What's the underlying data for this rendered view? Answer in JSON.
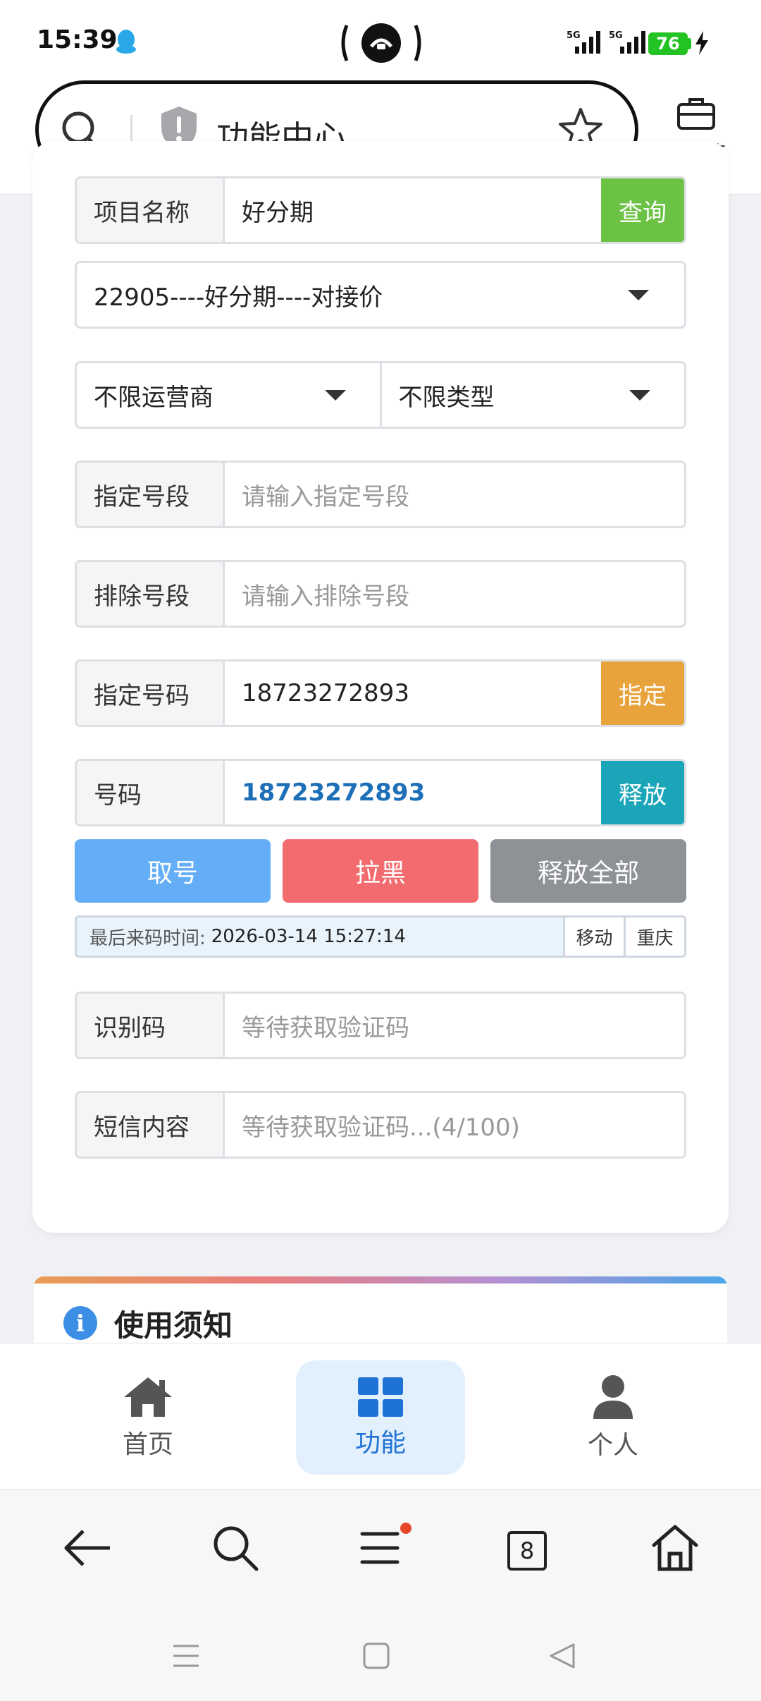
{
  "status_bar": {
    "time": "15:39",
    "network_1": "5G",
    "network_2": "5G",
    "battery": "76"
  },
  "browser": {
    "url_title": "功能中心",
    "toolbox_label": "工具箱",
    "tab_count": "8"
  },
  "form": {
    "project_label": "项目名称",
    "project_value": "好分期",
    "query_button": "查询",
    "project_select": "22905----好分期----对接价",
    "carrier_select": "不限运营商",
    "type_select": "不限类型",
    "segment_label": "指定号段",
    "segment_placeholder": "请输入指定号段",
    "exclude_label": "排除号段",
    "exclude_placeholder": "请输入排除号段",
    "assign_label": "指定号码",
    "assign_value": "18723272893",
    "assign_button": "指定",
    "number_label": "号码",
    "number_value": "18723272893",
    "release_button": "释放",
    "get_number_button": "取号",
    "blacklist_button": "拉黑",
    "release_all_button": "释放全部",
    "last_code_label": "最后来码时间:",
    "last_code_time": "2026-03-14 15:27:14",
    "carrier_tag": "移动",
    "region_tag": "重庆",
    "code_label": "识别码",
    "code_placeholder": "等待获取验证码",
    "sms_label": "短信内容",
    "sms_placeholder": "等待获取验证码...(4/100)"
  },
  "notice": {
    "title": "使用须知"
  },
  "bottom_nav": {
    "items": [
      {
        "label": "首页",
        "icon": "home-icon"
      },
      {
        "label": "功能",
        "icon": "grid-icon",
        "active": true
      },
      {
        "label": "个人",
        "icon": "user-icon"
      }
    ]
  },
  "colors": {
    "query_green": "#6cc244",
    "assign_orange": "#e8a33c",
    "release_teal": "#1ba5b8",
    "get_blue": "#64aef8",
    "blacklist_red": "#f26b6e",
    "release_all_gray": "#8e9196",
    "accent_blue": "#1f72d6"
  }
}
